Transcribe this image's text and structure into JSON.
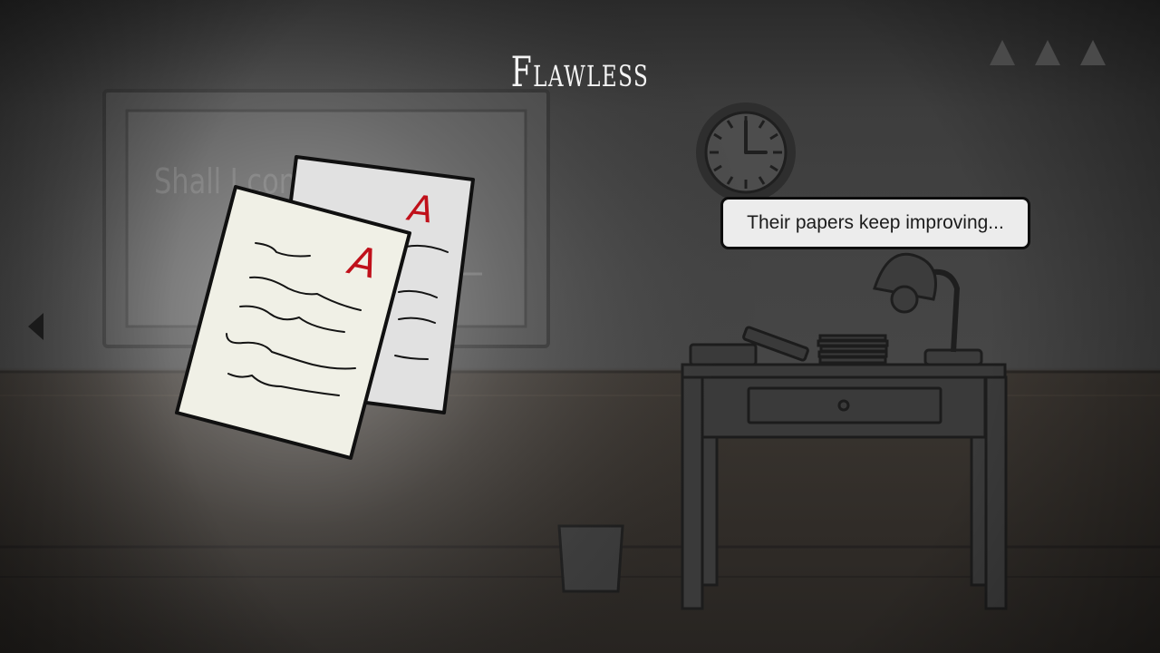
{
  "title": "Flawless",
  "dialog": {
    "text": "Their papers keep improving..."
  },
  "chalkboard": {
    "text": "Shall I con"
  },
  "grades": {
    "front_paper": "A",
    "back_paper": "A"
  },
  "clock": {
    "hour": 3,
    "minute": 0
  },
  "hints": {
    "count": 3,
    "icon": "triangle-icon"
  },
  "navigation": {
    "left_icon": "left-arrow-icon"
  },
  "colors": {
    "grade_red": "#c0101a",
    "dialog_bg": "#ececec"
  }
}
